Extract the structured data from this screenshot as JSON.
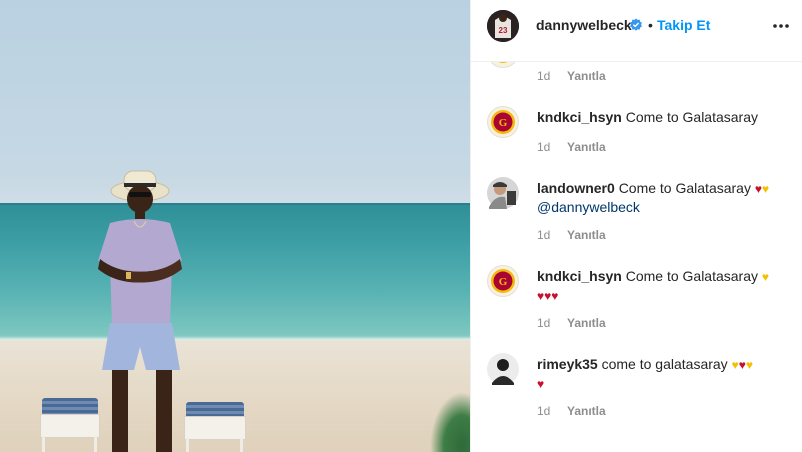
{
  "post": {
    "username": "dannywelbeck",
    "verified": true,
    "follow_label": "Takip Et",
    "separator": "•",
    "jersey_number": "23"
  },
  "comments": [
    {
      "partial": true,
      "time": "1d",
      "reply_label": "Yanıtla"
    },
    {
      "username": "kndkci_hsyn",
      "text": "Come to Galatasaray",
      "emojis": [],
      "avatar": "galatasaray-logo",
      "time": "1d",
      "reply_label": "Yanıtla"
    },
    {
      "username": "landowner0",
      "text": "Come to Galatasaray",
      "emojis": [
        "red-heart",
        "yellow-heart"
      ],
      "mention": "@dannywelbeck",
      "avatar": "person-photo",
      "time": "1d",
      "reply_label": "Yanıtla"
    },
    {
      "username": "kndkci_hsyn",
      "text": "Come to Galatasaray",
      "emojis": [
        "yellow-heart",
        "red-heart",
        "red-heart",
        "red-heart"
      ],
      "avatar": "galatasaray-logo",
      "time": "1d",
      "reply_label": "Yanıtla"
    },
    {
      "username": "rimeyk35",
      "text": "come to galatasaray",
      "emojis": [
        "yellow-heart",
        "red-heart",
        "yellow-heart",
        "red-heart"
      ],
      "avatar": "person-photo-bw",
      "time": "1d",
      "reply_label": "Yanıtla"
    }
  ],
  "colors": {
    "follow": "#0095f6",
    "muted": "#8e8e8e",
    "mention": "#00376b",
    "red_heart": "#c8102e",
    "yellow_heart": "#f2c200"
  }
}
